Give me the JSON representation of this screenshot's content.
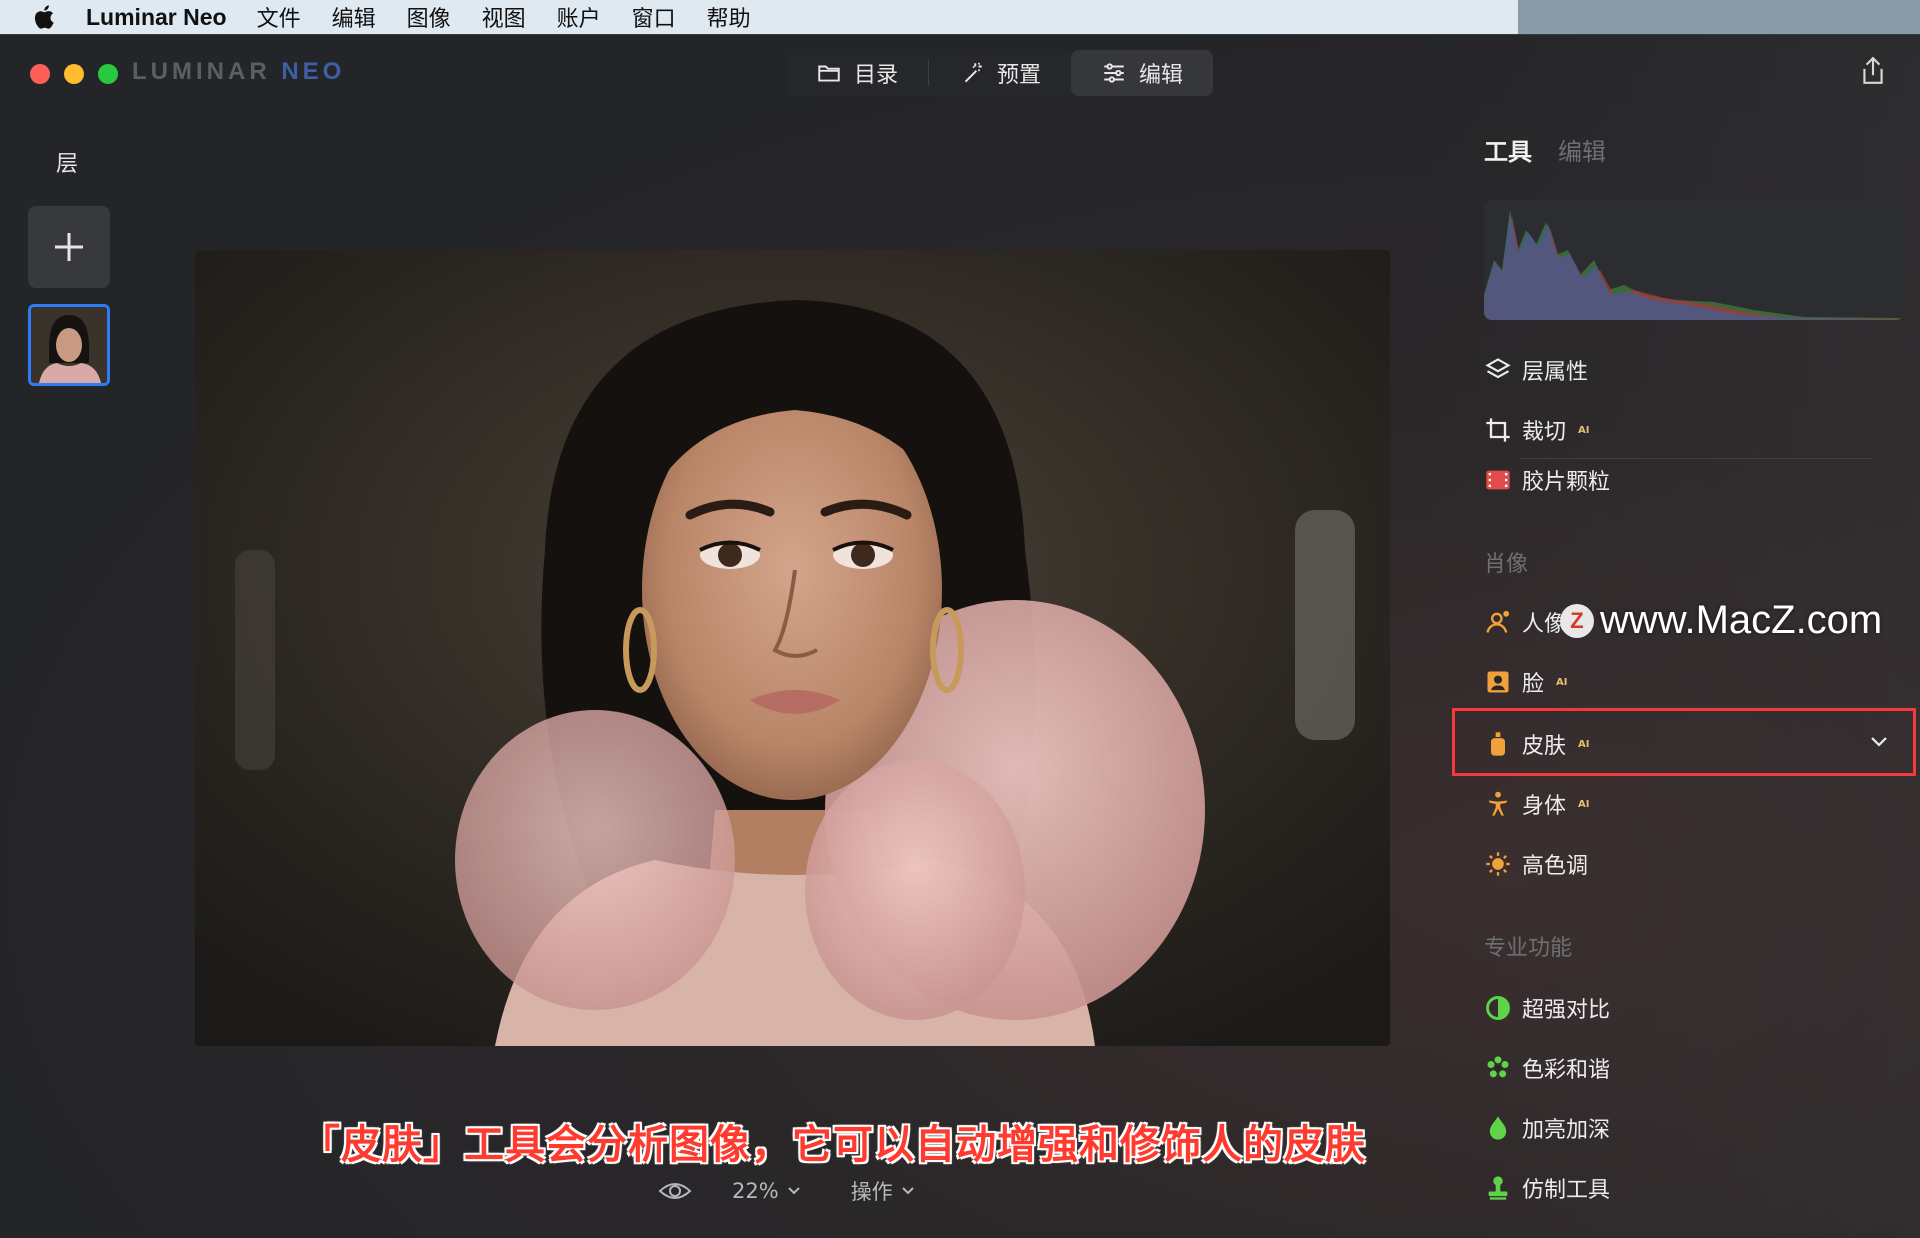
{
  "menubar": {
    "app_name": "Luminar Neo",
    "items": [
      "文件",
      "编辑",
      "图像",
      "视图",
      "账户",
      "窗口",
      "帮助"
    ]
  },
  "window": {
    "logo_left": "LUMINAR ",
    "logo_right": "NEO",
    "tabs": [
      {
        "label": "目录",
        "icon": "folder-icon",
        "active": false
      },
      {
        "label": "预置",
        "icon": "magic-wand-icon",
        "active": false
      },
      {
        "label": "编辑",
        "icon": "sliders-icon",
        "active": true
      }
    ]
  },
  "layers": {
    "title": "层",
    "add_icon": "plus-icon"
  },
  "right_panel": {
    "tabs": {
      "tools": "工具",
      "edit": "编辑"
    },
    "tools_top": [
      {
        "label": "层属性",
        "icon": "layers-icon",
        "ai": ""
      },
      {
        "label": "裁切",
        "icon": "crop-icon",
        "ai": "AI"
      },
      {
        "label": "胶片颗粒",
        "icon": "film-icon",
        "ai": ""
      }
    ],
    "portrait_section": "肖像",
    "portrait_tools": [
      {
        "label": "人像",
        "icon": "portrait-bokeh-icon",
        "ai": ""
      },
      {
        "label": "脸",
        "icon": "face-icon",
        "ai": "AI"
      },
      {
        "label": "皮肤",
        "icon": "skin-icon",
        "ai": "AI"
      },
      {
        "label": "身体",
        "icon": "body-icon",
        "ai": "AI"
      },
      {
        "label": "高色调",
        "icon": "high-key-icon",
        "ai": ""
      }
    ],
    "pro_section": "专业功能",
    "pro_tools": [
      {
        "label": "超强对比",
        "icon": "contrast-icon",
        "ai": ""
      },
      {
        "label": "色彩和谐",
        "icon": "color-harmony-icon",
        "ai": ""
      },
      {
        "label": "加亮加深",
        "icon": "dodge-burn-icon",
        "ai": ""
      },
      {
        "label": "仿制工具",
        "icon": "clone-stamp-icon",
        "ai": ""
      }
    ],
    "colors": {
      "highlight": "#f43a3a",
      "ai_badge": "#e2c16b",
      "accent": "#2e7bf6"
    }
  },
  "bottom": {
    "zoom": "22%",
    "actions": "操作",
    "caption": "「皮肤」工具会分析图像，它可以自动增强和修饰人的皮肤"
  },
  "watermark": {
    "badge": "Z",
    "text": "www.MacZ.com"
  }
}
